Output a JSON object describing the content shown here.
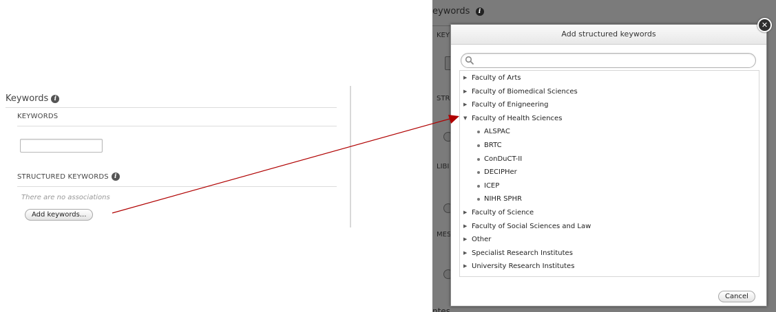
{
  "left": {
    "section_title": "Keywords",
    "keywords_label": "KEYWORDS",
    "keywords_value": "",
    "structured_label": "STRUCTURED KEYWORDS",
    "no_associations": "There are no associations",
    "add_button": "Add keywords..."
  },
  "background": {
    "title": "eywords",
    "labels": [
      "KEY",
      "STR",
      "LIBI",
      "MES",
      "ntes"
    ]
  },
  "dialog": {
    "title": "Add structured keywords",
    "search_placeholder": "",
    "tree": [
      {
        "label": "Faculty of Arts",
        "expanded": false
      },
      {
        "label": "Faculty of Biomedical Sciences",
        "expanded": false
      },
      {
        "label": "Faculty of Enigneering",
        "expanded": false
      },
      {
        "label": "Faculty of Health Sciences",
        "expanded": true
      },
      {
        "label": "ALSPAC",
        "child": true
      },
      {
        "label": "BRTC",
        "child": true
      },
      {
        "label": "ConDuCT-II",
        "child": true
      },
      {
        "label": "DECIPHer",
        "child": true
      },
      {
        "label": "ICEP",
        "child": true
      },
      {
        "label": "NIHR SPHR",
        "child": true
      },
      {
        "label": "Faculty of Science",
        "expanded": false
      },
      {
        "label": "Faculty of Social Sciences and Law",
        "expanded": false
      },
      {
        "label": "Other",
        "expanded": false
      },
      {
        "label": "Specialist Research Institutes",
        "expanded": false
      },
      {
        "label": "University Research Institutes",
        "expanded": false
      }
    ],
    "cancel_button": "Cancel",
    "close_icon": "close-icon"
  },
  "colors": {
    "overlay": "#7b7b7b",
    "arrow": "#b00000"
  }
}
